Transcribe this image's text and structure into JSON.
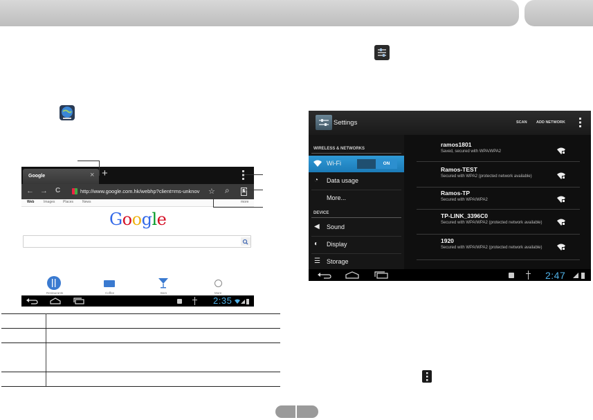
{
  "browser": {
    "tab_title": "Google",
    "tab_close": "×",
    "new_tab": "+",
    "url": "http://www.google.com.hk/webhp?client=ms-unknov",
    "nav_back": "←",
    "nav_forward": "→",
    "nav_reload": "C",
    "search_glyph": "⌕",
    "star_glyph": "☆",
    "links": [
      "Web",
      "Images",
      "Places",
      "News",
      "more"
    ],
    "logo": [
      "G",
      "o",
      "o",
      "g",
      "l",
      "e"
    ],
    "logo_colors": [
      "#3369e8",
      "#d50f25",
      "#eeb211",
      "#3369e8",
      "#009925",
      "#d50f25"
    ],
    "quick_links": [
      "Restaurants",
      "Coffee",
      "Bars",
      "More"
    ],
    "clock": "2:35"
  },
  "settings": {
    "title": "Settings",
    "scan": "SCAN",
    "add_network": "ADD NETWORK",
    "section_wireless": "WIRELESS & NETWORKS",
    "section_device": "DEVICE",
    "items": {
      "wifi": "Wi-Fi",
      "wifi_toggle": "ON",
      "data_usage": "Data usage",
      "more": "More...",
      "sound": "Sound",
      "display": "Display",
      "storage": "Storage"
    },
    "networks": [
      {
        "name": "ramos1801",
        "status": "Saved, secured with WPA/WPA2"
      },
      {
        "name": "Ramos-TEST",
        "status": "Secured with WPA2 (protected network available)"
      },
      {
        "name": "Ramos-TP",
        "status": "Secured with WPA/WPA2"
      },
      {
        "name": "TP-LINK_3396C0",
        "status": "Secured with WPA/WPA2 (protected network available)"
      },
      {
        "name": "1920",
        "status": "Secured with WPA/WPA2 (protected network available)"
      }
    ],
    "clock": "2:47"
  }
}
